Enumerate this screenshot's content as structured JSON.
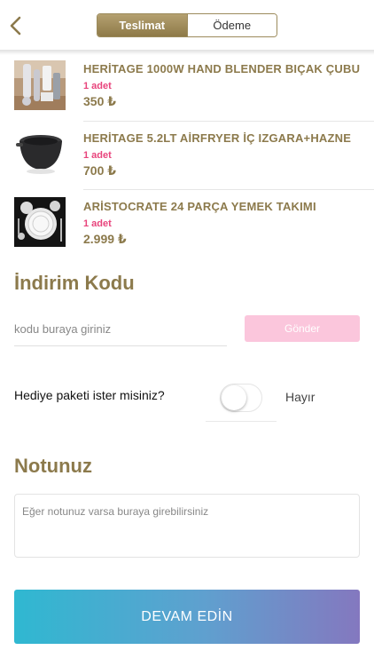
{
  "header": {
    "tabs": [
      {
        "label": "Teslimat",
        "active": true
      },
      {
        "label": "Ödeme",
        "active": false
      }
    ],
    "back_icon": "chevron-left-icon"
  },
  "cart": {
    "items": [
      {
        "name": "HERİTAGE 1000W HAND BLENDER BIÇAK ÇUBU",
        "quantity": "1 adet",
        "price": "350 ₺",
        "image": "hand-blender-image"
      },
      {
        "name": "HERİTAGE 5.2LT AİRFRYER İÇ IZGARA+HAZNE",
        "quantity": "1 adet",
        "price": "700 ₺",
        "image": "airfryer-basket-image"
      },
      {
        "name": "ARİSTOCRATE 24 PARÇA YEMEK TAKIMI",
        "quantity": "1 adet",
        "price": "2.999 ₺",
        "image": "dinnerware-set-image"
      }
    ]
  },
  "discount": {
    "title": "İndirim Kodu",
    "placeholder": "kodu buraya giriniz",
    "button_label": "Gönder"
  },
  "gift": {
    "question": "Hediye paketi ister misiniz?",
    "value_label": "Hayır",
    "enabled": false
  },
  "note": {
    "title": "Notunuz",
    "placeholder": "Eğer notunuz varsa buraya girebilirsiniz"
  },
  "footer": {
    "continue_label": "DEVAM EDİN"
  },
  "colors": {
    "brand_gold": "#8c7a4c",
    "quantity_pink": "#e8447c",
    "send_button_pink": "#fbc6dc",
    "gradient_start": "#2fb8d1",
    "gradient_end": "#8478bf"
  }
}
